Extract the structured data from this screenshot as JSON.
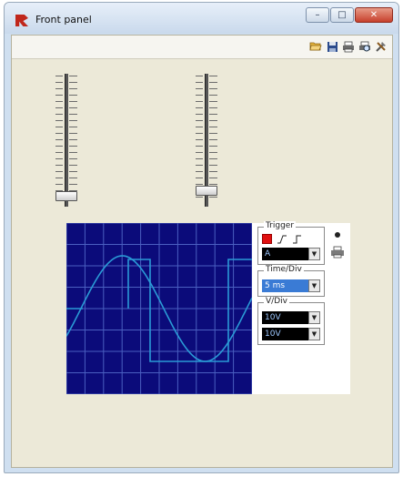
{
  "window": {
    "title": "Front panel",
    "controls": {
      "minimize": "–",
      "maximize": "□",
      "close": "✕"
    }
  },
  "toolbar": {
    "icons": [
      "open-folder-icon",
      "save-icon",
      "print-icon",
      "print-preview-icon",
      "tools-icon"
    ]
  },
  "sliders": [
    {
      "name": "slider-left",
      "level": 0.06
    },
    {
      "name": "slider-right",
      "level": 0.1
    }
  ],
  "oscilloscope": {
    "trigger": {
      "label": "Trigger",
      "source": "A"
    },
    "time_div": {
      "label": "Time/Div",
      "value": "5 ms"
    },
    "v_div": {
      "label": "V/Div",
      "channel_a": "10V",
      "channel_b": "10V"
    },
    "side_icons": [
      "pin-icon",
      "printer-icon"
    ],
    "colors": {
      "screen": "#0b0b7a",
      "grid": "#4a5fc0",
      "trace": "#2a9ad6"
    }
  }
}
